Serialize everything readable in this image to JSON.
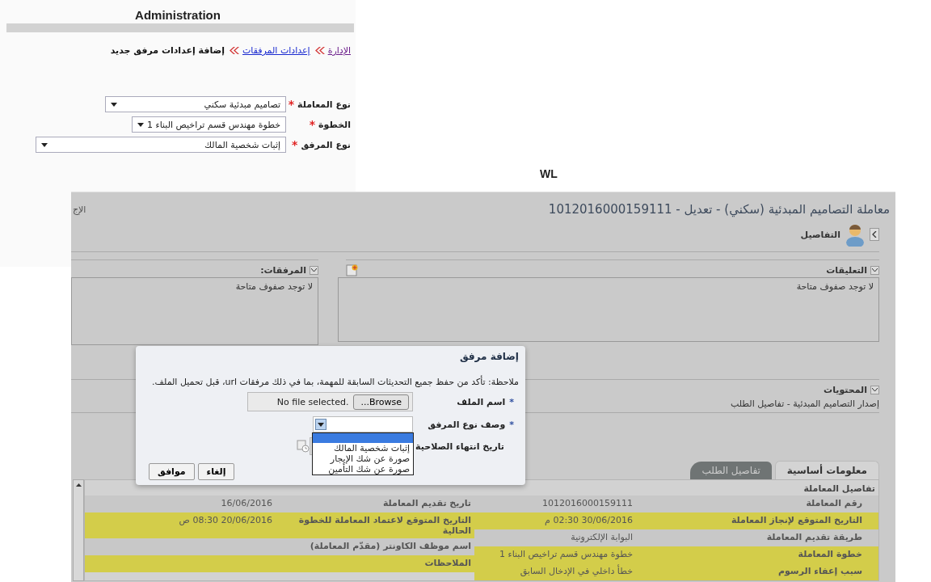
{
  "admin": {
    "title": "Administration",
    "breadcrumb": [
      {
        "label": "الإدارة",
        "kind": "visited-link"
      },
      {
        "label": "إعدادات المرفقات",
        "kind": "link"
      },
      {
        "label": "إضافة إعدادات مرفق جديد",
        "kind": "current"
      }
    ],
    "fields": [
      {
        "label": "نوع المعاملة",
        "mark": "*",
        "value": "تصاميم مبدئية سكني"
      },
      {
        "label": "الخطوة",
        "mark": "*",
        "value": "خطوة مهندس قسم تراخيص البناء 1"
      },
      {
        "label": "نوع المرفق",
        "mark": "*",
        "value": "إثبات شخصية المالك"
      }
    ]
  },
  "wl": {
    "label": "WL",
    "title": "معاملة التصاميم المبدئية (سكني) - تعديل - 1012016000159111",
    "cut_text": "الإج",
    "details_link": "التفاصيل",
    "comments": {
      "title": "التعليقات",
      "empty": "لا توجد صفوف متاحة"
    },
    "attachments": {
      "title": "المرفقات:",
      "empty": "لا توجد صفوف متاحة"
    },
    "contents": {
      "title": "المحتويات",
      "subtitle": "إصدار التصاميم المبدئية - تفاصيل الطلب"
    },
    "tabs": [
      {
        "label": "معلومات أساسية",
        "selected": true
      },
      {
        "label": "تفاصيل الطلب",
        "selected": false
      }
    ],
    "details": {
      "title": "تفاصيل المعاملة",
      "columns": [
        {
          "cells": [
            {
              "label": "رقم المعاملة",
              "value": "1012016000159111",
              "highlighted": false
            },
            {
              "label": "التاريخ المتوقع لإنجاز المعاملة",
              "value": "30/06/2016 02:30 م",
              "highlighted": true
            },
            {
              "label": "طريقة تقديم المعاملة",
              "value": "البوابة الإلكترونية",
              "highlighted": false
            },
            {
              "label": "خطوة المعاملة",
              "value": "خطوة مهندس قسم تراخيص البناء 1",
              "highlighted": true
            },
            {
              "label": "سبب إعفاء الرسوم",
              "value": "خطأ داخلي في الإدخال السابق",
              "highlighted": true
            }
          ]
        },
        {
          "cells": [
            {
              "label": "تاريخ تقديم المعاملة",
              "value": "16/06/2016",
              "highlighted": false
            },
            {
              "label": "التاريخ المتوقع لاعتماد المعاملة للخطوة الحالية",
              "value": "20/06/2016 08:30 ص",
              "highlighted": true
            },
            {
              "label": "اسم موظف الكاونتر (مقدّم المعاملة)",
              "highlighted": false
            },
            {
              "label": "الملاحظات",
              "highlighted": true
            }
          ]
        }
      ]
    }
  },
  "dialog": {
    "title": "إضافة مرفق",
    "note": "ملاحظة: تأكد من حفظ جميع التحديثات السابقة للمهمة، بما في ذلك مرفقات url، قبل تحميل الملف.",
    "fields": [
      {
        "kind": "file",
        "mark": "*",
        "label": "اسم الملف",
        "button": "Browse...",
        "status": "No file selected."
      },
      {
        "kind": "select",
        "mark": "*",
        "label": "وصف نوع المرفق",
        "expanded": true,
        "options": [
          "إثبات شخصية المالك",
          "صورة عن شك الإيجار",
          "صورة عن شك التأمين"
        ]
      },
      {
        "kind": "date",
        "label": "تاريخ انتهاء الصلاحية"
      }
    ],
    "buttons": [
      "إلغاء",
      "موافق"
    ]
  }
}
